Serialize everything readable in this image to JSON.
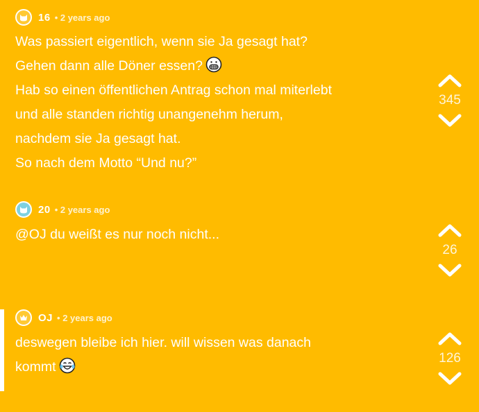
{
  "colors": {
    "background": "#FFBB00",
    "text": "#FFFFFF",
    "avatar_16": "#FFC933",
    "avatar_20": "#7FD1E0",
    "avatar_oj": "#FFC933"
  },
  "comments": [
    {
      "username": "16",
      "time": "2 years ago",
      "avatar_icon": "cat-icon",
      "lines": [
        "Was passiert eigentlich, wenn sie Ja gesagt hat?",
        "Gehen dann alle Döner essen?",
        "Hab so einen öffentlichen Antrag schon mal miterlebt",
        "und alle standen richtig unangenehm herum,",
        "nachdem sie Ja gesagt hat.",
        "So nach dem Motto “Und nu?”"
      ],
      "votes": "345"
    },
    {
      "username": "20",
      "time": "2 years ago",
      "avatar_icon": "cat-icon",
      "lines": [
        "@OJ du weißt es nur noch nicht..."
      ],
      "votes": "26"
    },
    {
      "username": "OJ",
      "time": "2 years ago",
      "avatar_icon": "crown-icon",
      "lines": [
        "deswegen bleibe ich hier. will wissen was danach",
        "kommt"
      ],
      "votes": "126"
    }
  ]
}
